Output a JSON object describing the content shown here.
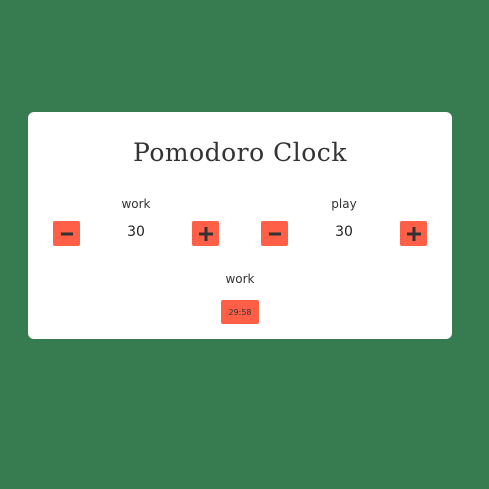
{
  "title": "Pomodoro Clock",
  "work": {
    "label": "work",
    "value": "30"
  },
  "play": {
    "label": "play",
    "value": "30"
  },
  "session": {
    "label": "work",
    "time": "29:58"
  },
  "icons": {
    "decrement": "minus-icon",
    "increment": "plus-icon"
  },
  "colors": {
    "background": "#377b50",
    "card": "#ffffff",
    "accent": "#ff5f46"
  }
}
